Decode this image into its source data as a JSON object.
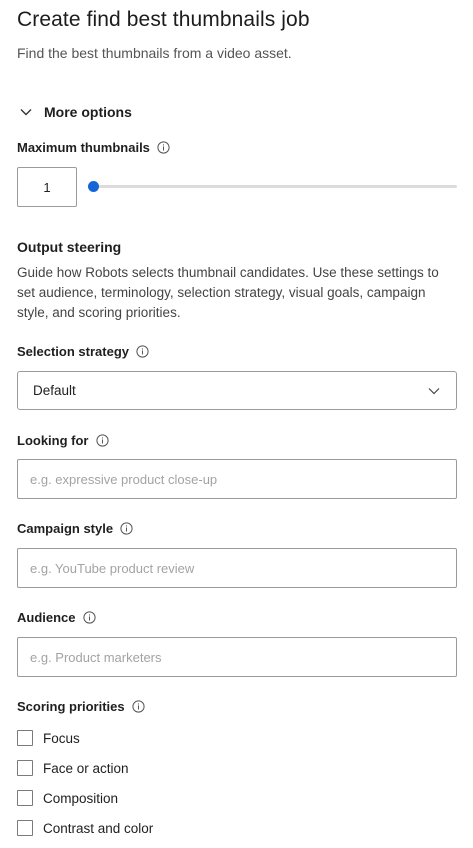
{
  "header": {
    "title": "Create find best thumbnails job",
    "subtitle": "Find the best thumbnails from a video asset."
  },
  "more_options": {
    "label": "More options",
    "icon": "chevron-down-icon",
    "expanded": true
  },
  "max_thumbnails": {
    "label": "Maximum thumbnails",
    "value": "1",
    "slider_fraction": 0,
    "accent_color": "#1565d8"
  },
  "output_steering": {
    "title": "Output steering",
    "description": "Guide how Robots selects thumbnail candidates. Use these settings to set audience, terminology, selection strategy, visual goals, campaign style, and scoring priorities."
  },
  "selection_strategy": {
    "label": "Selection strategy",
    "value": "Default"
  },
  "looking_for": {
    "label": "Looking for",
    "placeholder": "e.g. expressive product close-up"
  },
  "campaign_style": {
    "label": "Campaign style",
    "placeholder": "e.g. YouTube product review"
  },
  "audience": {
    "label": "Audience",
    "placeholder": "e.g. Product marketers"
  },
  "scoring_priorities": {
    "label": "Scoring priorities",
    "options": [
      {
        "label": "Focus",
        "checked": false
      },
      {
        "label": "Face or action",
        "checked": false
      },
      {
        "label": "Composition",
        "checked": false
      },
      {
        "label": "Contrast and color",
        "checked": false
      }
    ]
  }
}
